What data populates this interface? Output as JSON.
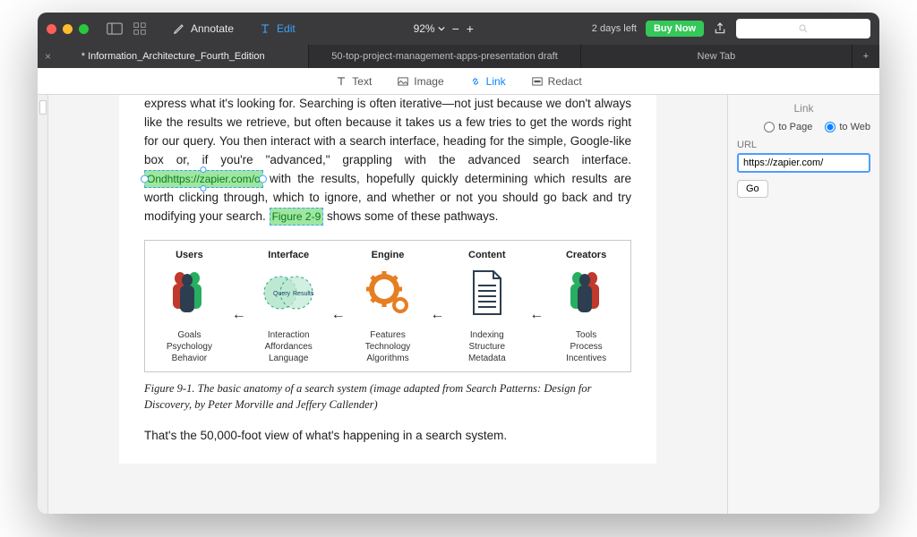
{
  "toolbar": {
    "annotate_label": "Annotate",
    "edit_label": "Edit",
    "zoom_pct": "92%",
    "trial_label": "2 days left",
    "buy_label": "Buy Now",
    "search_placeholder": "Search"
  },
  "tabs": [
    {
      "label": "* Information_Architecture_Fourth_Edition",
      "active": true,
      "closable": true
    },
    {
      "label": "50-top-project-management-apps-presentation draft",
      "active": false
    },
    {
      "label": "New Tab",
      "active": false
    }
  ],
  "subtoolbar": {
    "text": "Text",
    "image": "Image",
    "link": "Link",
    "redact": "Redact"
  },
  "document": {
    "para1_a": "express what it's looking for. Searching is often iterative—not just because we don't always like the results we retrieve, but often because it takes us a few tries to get the words right for our query. You then interact with a search interface, heading for the simple, Google-like box or, if you're \"advanced,\" grappling with the advanced search interface. ",
    "link1_text": "Ondhttps://zapier.com/o",
    "para1_b": " with the results, hopefully quickly determining which results are worth clicking through, which to ignore, and whether or not you should go back and try modifying your search. ",
    "link2_text": "Figure 2-9",
    "para1_c": " shows some of these pathways.",
    "figure": {
      "cols": [
        {
          "header": "Users",
          "sub": "Goals\nPsychology\nBehavior"
        },
        {
          "header": "Interface",
          "sub": "Interaction\nAffordances\nLanguage"
        },
        {
          "header": "Engine",
          "sub": "Features\nTechnology\nAlgorithms"
        },
        {
          "header": "Content",
          "sub": "Indexing\nStructure\nMetadata"
        },
        {
          "header": "Creators",
          "sub": "Tools\nProcess\nIncentives"
        }
      ]
    },
    "caption": "Figure 9-1. The basic anatomy of a search system (image adapted from Search Patterns: Design for Discovery, by Peter Morville and Jeffery Callender)",
    "para2": "That's the 50,000-foot view of what's happening in a search system."
  },
  "panel": {
    "title": "Link",
    "radio_page": "to Page",
    "radio_web": "to Web",
    "url_label": "URL",
    "url_value": "https://zapier.com/",
    "go_label": "Go"
  }
}
